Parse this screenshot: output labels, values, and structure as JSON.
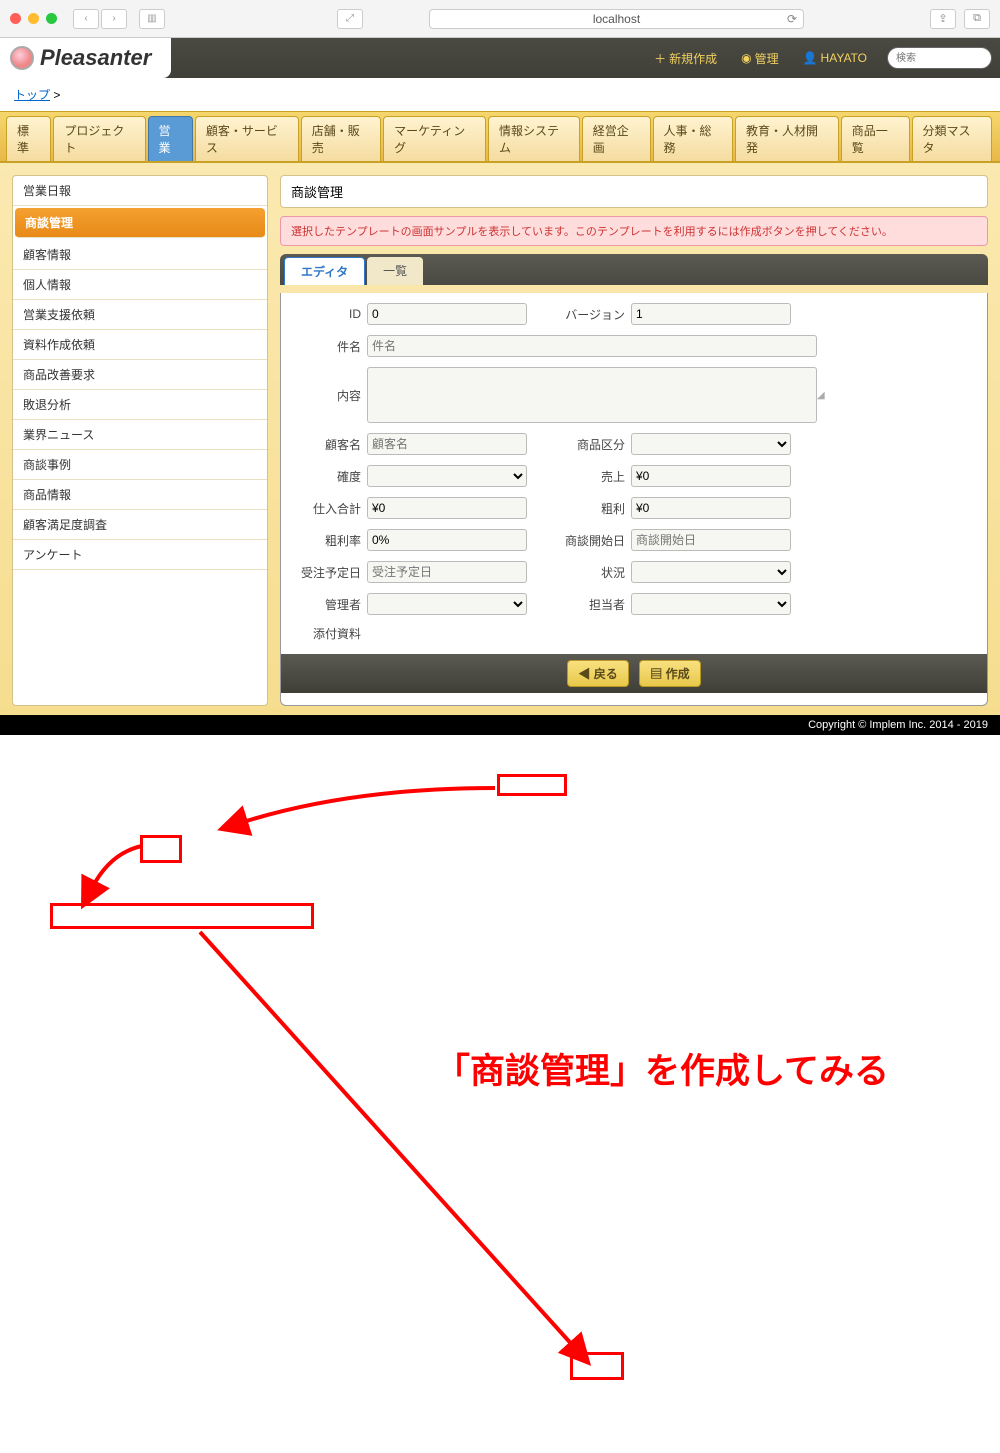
{
  "browser": {
    "address": "localhost"
  },
  "app": {
    "name": "Pleasanter",
    "header": {
      "new": "新規作成",
      "manage": "管理",
      "user": "HAYATO",
      "search_ph": "検索"
    },
    "breadcrumb": {
      "top": "トップ",
      "sep": ">"
    }
  },
  "tabs": [
    "標準",
    "プロジェクト",
    "営業",
    "顧客・サービス",
    "店舗・販売",
    "マーケティング",
    "情報システム",
    "経営企画",
    "人事・総務",
    "教育・人材開発",
    "商品一覧",
    "分類マスタ"
  ],
  "tabs_active": 2,
  "sidebar": [
    "営業日報",
    "商談管理",
    "顧客情報",
    "個人情報",
    "営業支援依頼",
    "資料作成依頼",
    "商品改善要求",
    "敗退分析",
    "業界ニュース",
    "商談事例",
    "商品情報",
    "顧客満足度調査",
    "アンケート"
  ],
  "sidebar_active": 1,
  "main": {
    "title": "商談管理",
    "notice": "選択したテンプレートの画面サンプルを表示しています。このテンプレートを利用するには作成ボタンを押してください。",
    "subtabs": {
      "editor": "エディタ",
      "list": "一覧"
    }
  },
  "form": {
    "id_l": "ID",
    "id_v": "0",
    "ver_l": "バージョン",
    "ver_v": "1",
    "name_l": "件名",
    "name_ph": "件名",
    "body_l": "内容",
    "cust_l": "顧客名",
    "cust_ph": "顧客名",
    "prodcat_l": "商品区分",
    "prob_l": "確度",
    "sales_l": "売上",
    "sales_v": "¥0",
    "cost_l": "仕入合計",
    "cost_v": "¥0",
    "margin_l": "粗利",
    "margin_v": "¥0",
    "rate_l": "粗利率",
    "rate_v": "0%",
    "start_l": "商談開始日",
    "start_ph": "商談開始日",
    "order_l": "受注予定日",
    "order_ph": "受注予定日",
    "status_l": "状況",
    "mgr_l": "管理者",
    "owner_l": "担当者",
    "attach_l": "添付資料"
  },
  "buttons": {
    "back": "戻る",
    "create": "作成"
  },
  "footer": "Copyright © Implem Inc. 2014 - 2019",
  "annotation": "「商談管理」を作成してみる"
}
